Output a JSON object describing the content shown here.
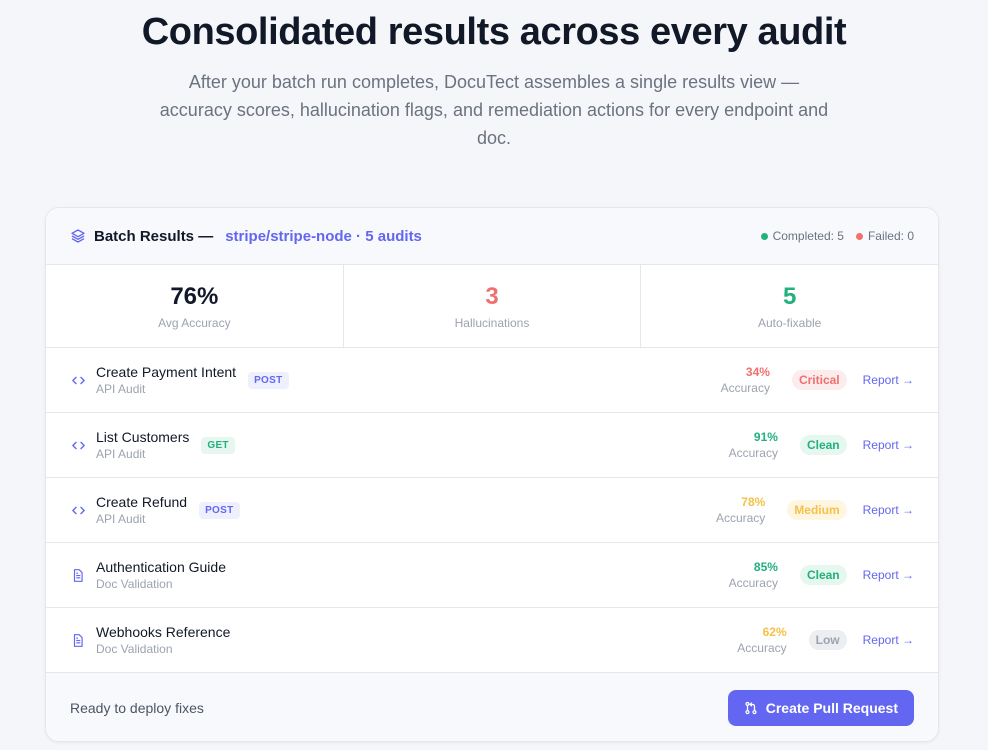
{
  "hero": {
    "title": "Consolidated results across every audit",
    "subtitle": "After your batch run completes, DocuTect assembles a single results view — accuracy scores, hallucination flags, and remediation actions for every endpoint and doc."
  },
  "card": {
    "title": "Batch Results —",
    "repo": "stripe/stripe-node · 5 audits",
    "completed": "Completed: 5",
    "failed": "Failed: 0"
  },
  "stats": [
    {
      "value": "76%",
      "label": "Avg Accuracy",
      "color": "#111827"
    },
    {
      "value": "3",
      "label": "Hallucinations",
      "color": "#f07070"
    },
    {
      "value": "5",
      "label": "Auto-fixable",
      "color": "#22b07d"
    }
  ],
  "rows": [
    {
      "icon": "code-icon",
      "name": "Create Payment Intent",
      "type": "API Audit",
      "method": "POST",
      "accuracy": "34%",
      "accuracy_label": "Accuracy",
      "accuracy_color": "#f07070",
      "badge": "Critical",
      "badge_bg": "#fdecec",
      "badge_fg": "#f07070",
      "report": "Report →"
    },
    {
      "icon": "code-icon",
      "name": "List Customers",
      "type": "API Audit",
      "method": "GET",
      "accuracy": "91%",
      "accuracy_label": "Accuracy",
      "accuracy_color": "#22b07d",
      "badge": "Clean",
      "badge_bg": "#e6f7ef",
      "badge_fg": "#22b07d",
      "report": "Report →"
    },
    {
      "icon": "code-icon",
      "name": "Create Refund",
      "type": "API Audit",
      "method": "POST",
      "accuracy": "78%",
      "accuracy_label": "Accuracy",
      "accuracy_color": "#f5c148",
      "badge": "Medium",
      "badge_bg": "#fef6e0",
      "badge_fg": "#f5c148",
      "report": "Report →"
    },
    {
      "icon": "document-icon",
      "name": "Authentication Guide",
      "type": "Doc Validation",
      "method": "",
      "accuracy": "85%",
      "accuracy_label": "Accuracy",
      "accuracy_color": "#22b07d",
      "badge": "Clean",
      "badge_bg": "#e6f7ef",
      "badge_fg": "#22b07d",
      "report": "Report →"
    },
    {
      "icon": "document-icon",
      "name": "Webhooks Reference",
      "type": "Doc Validation",
      "method": "",
      "accuracy": "62%",
      "accuracy_label": "Accuracy",
      "accuracy_color": "#f5c148",
      "badge": "Low",
      "badge_bg": "#eceef1",
      "badge_fg": "#9ca3af",
      "report": "Report →"
    }
  ],
  "footer": {
    "text": "Ready to deploy fixes",
    "button": "Create Pull Request"
  },
  "colors": {
    "accent": "#6366f1",
    "completed_dot": "#22b07d",
    "failed_dot": "#f07070",
    "post_bg": "#eef0fe",
    "post_fg": "#6366f1",
    "get_bg": "#e6f7ef",
    "get_fg": "#22b07d"
  }
}
